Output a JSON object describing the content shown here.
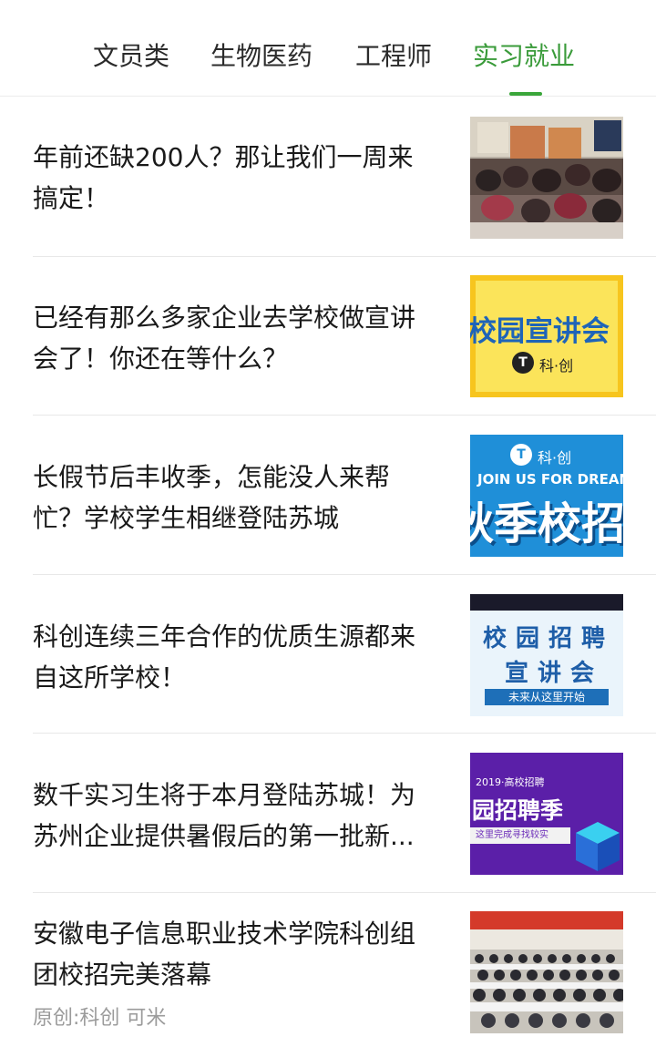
{
  "tabs": [
    {
      "label": "文员类",
      "active": false
    },
    {
      "label": "生物医药",
      "active": false
    },
    {
      "label": "工程师",
      "active": false
    },
    {
      "label": "实习就业",
      "active": true
    }
  ],
  "colors": {
    "active_tab": "#3a9b3a",
    "text": "#1a1a1a",
    "meta": "#9b9b9b"
  },
  "articles": [
    {
      "title_line1": "年前还缺200人？那让我们一周来",
      "title_line2": "搞定！",
      "thumb": {
        "kind": "classroom-photo"
      }
    },
    {
      "title_line1": "已经有那么多家企业去学校做宣讲",
      "title_line2": "会了！你还在等什么？",
      "thumb": {
        "kind": "banner",
        "headline": "校园宣讲会",
        "brand": "科·创"
      }
    },
    {
      "title_line1": "长假节后丰收季，怎能没人来帮",
      "title_line2": "忙？学校学生相继登陆苏城",
      "thumb": {
        "kind": "banner",
        "brand": "科·创",
        "slogan": "JOIN US FOR DREAM",
        "headline": "秋季校招"
      }
    },
    {
      "title_line1": "科创连续三年合作的优质生源都来",
      "title_line2": "自这所学校！",
      "thumb": {
        "kind": "banner",
        "line1": "校园招聘",
        "line2": "宣讲会",
        "footer": "未来从这里开始"
      }
    },
    {
      "title_line1": "数千实习生将于本月登陆苏城！为",
      "title_line2": "苏州企业提供暑假后的第一批新...",
      "thumb": {
        "kind": "banner",
        "tag": "2019·高校招聘",
        "headline": "园招聘季",
        "ribbon": "这里完成寻找较实"
      }
    },
    {
      "title_line1": "安徽电子信息职业技术学院科创组",
      "title_line2": "团校招完美落幕",
      "meta": "原创:科创 可米",
      "thumb": {
        "kind": "auditorium-photo"
      }
    }
  ]
}
